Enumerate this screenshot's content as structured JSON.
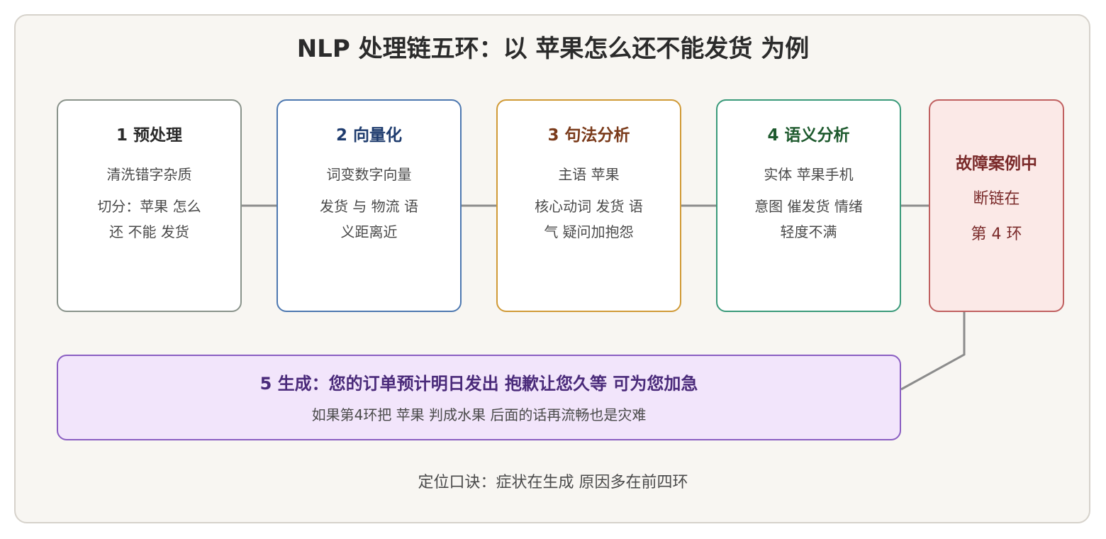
{
  "title": "NLP 处理链五环：以 苹果怎么还不能发货 为例",
  "steps": [
    {
      "heading": "1 预处理",
      "line1": "清洗错字杂质",
      "line2": "切分：苹果 怎么 还 不能 发货"
    },
    {
      "heading": "2 向量化",
      "line1": "词变数字向量",
      "line2": "发货 与 物流 语义距离近"
    },
    {
      "heading": "3 句法分析",
      "line1": "主语 苹果",
      "line2": "核心动词 发货 语气 疑问加抱怨"
    },
    {
      "heading": "4 语义分析",
      "line1": "实体 苹果手机",
      "line2": "意图 催发货 情绪 轻度不满"
    }
  ],
  "fault": {
    "heading": "故障案例中",
    "line1": "断链在",
    "line2": "第 4 环"
  },
  "generation": {
    "heading": "5 生成：您的订单预计明日发出 抱歉让您久等 可为您加急",
    "note": "如果第4环把 苹果 判成水果 后面的话再流畅也是灾难"
  },
  "footer": "定位口诀：症状在生成 原因多在前四环",
  "colors": {
    "step1": "#8a938b",
    "step2": "#4d78b0",
    "step3": "#d09a36",
    "step4": "#3a9a7a",
    "fault": "#c06060",
    "generation": "#8a5ec2",
    "connector": "#8c8c8c"
  }
}
